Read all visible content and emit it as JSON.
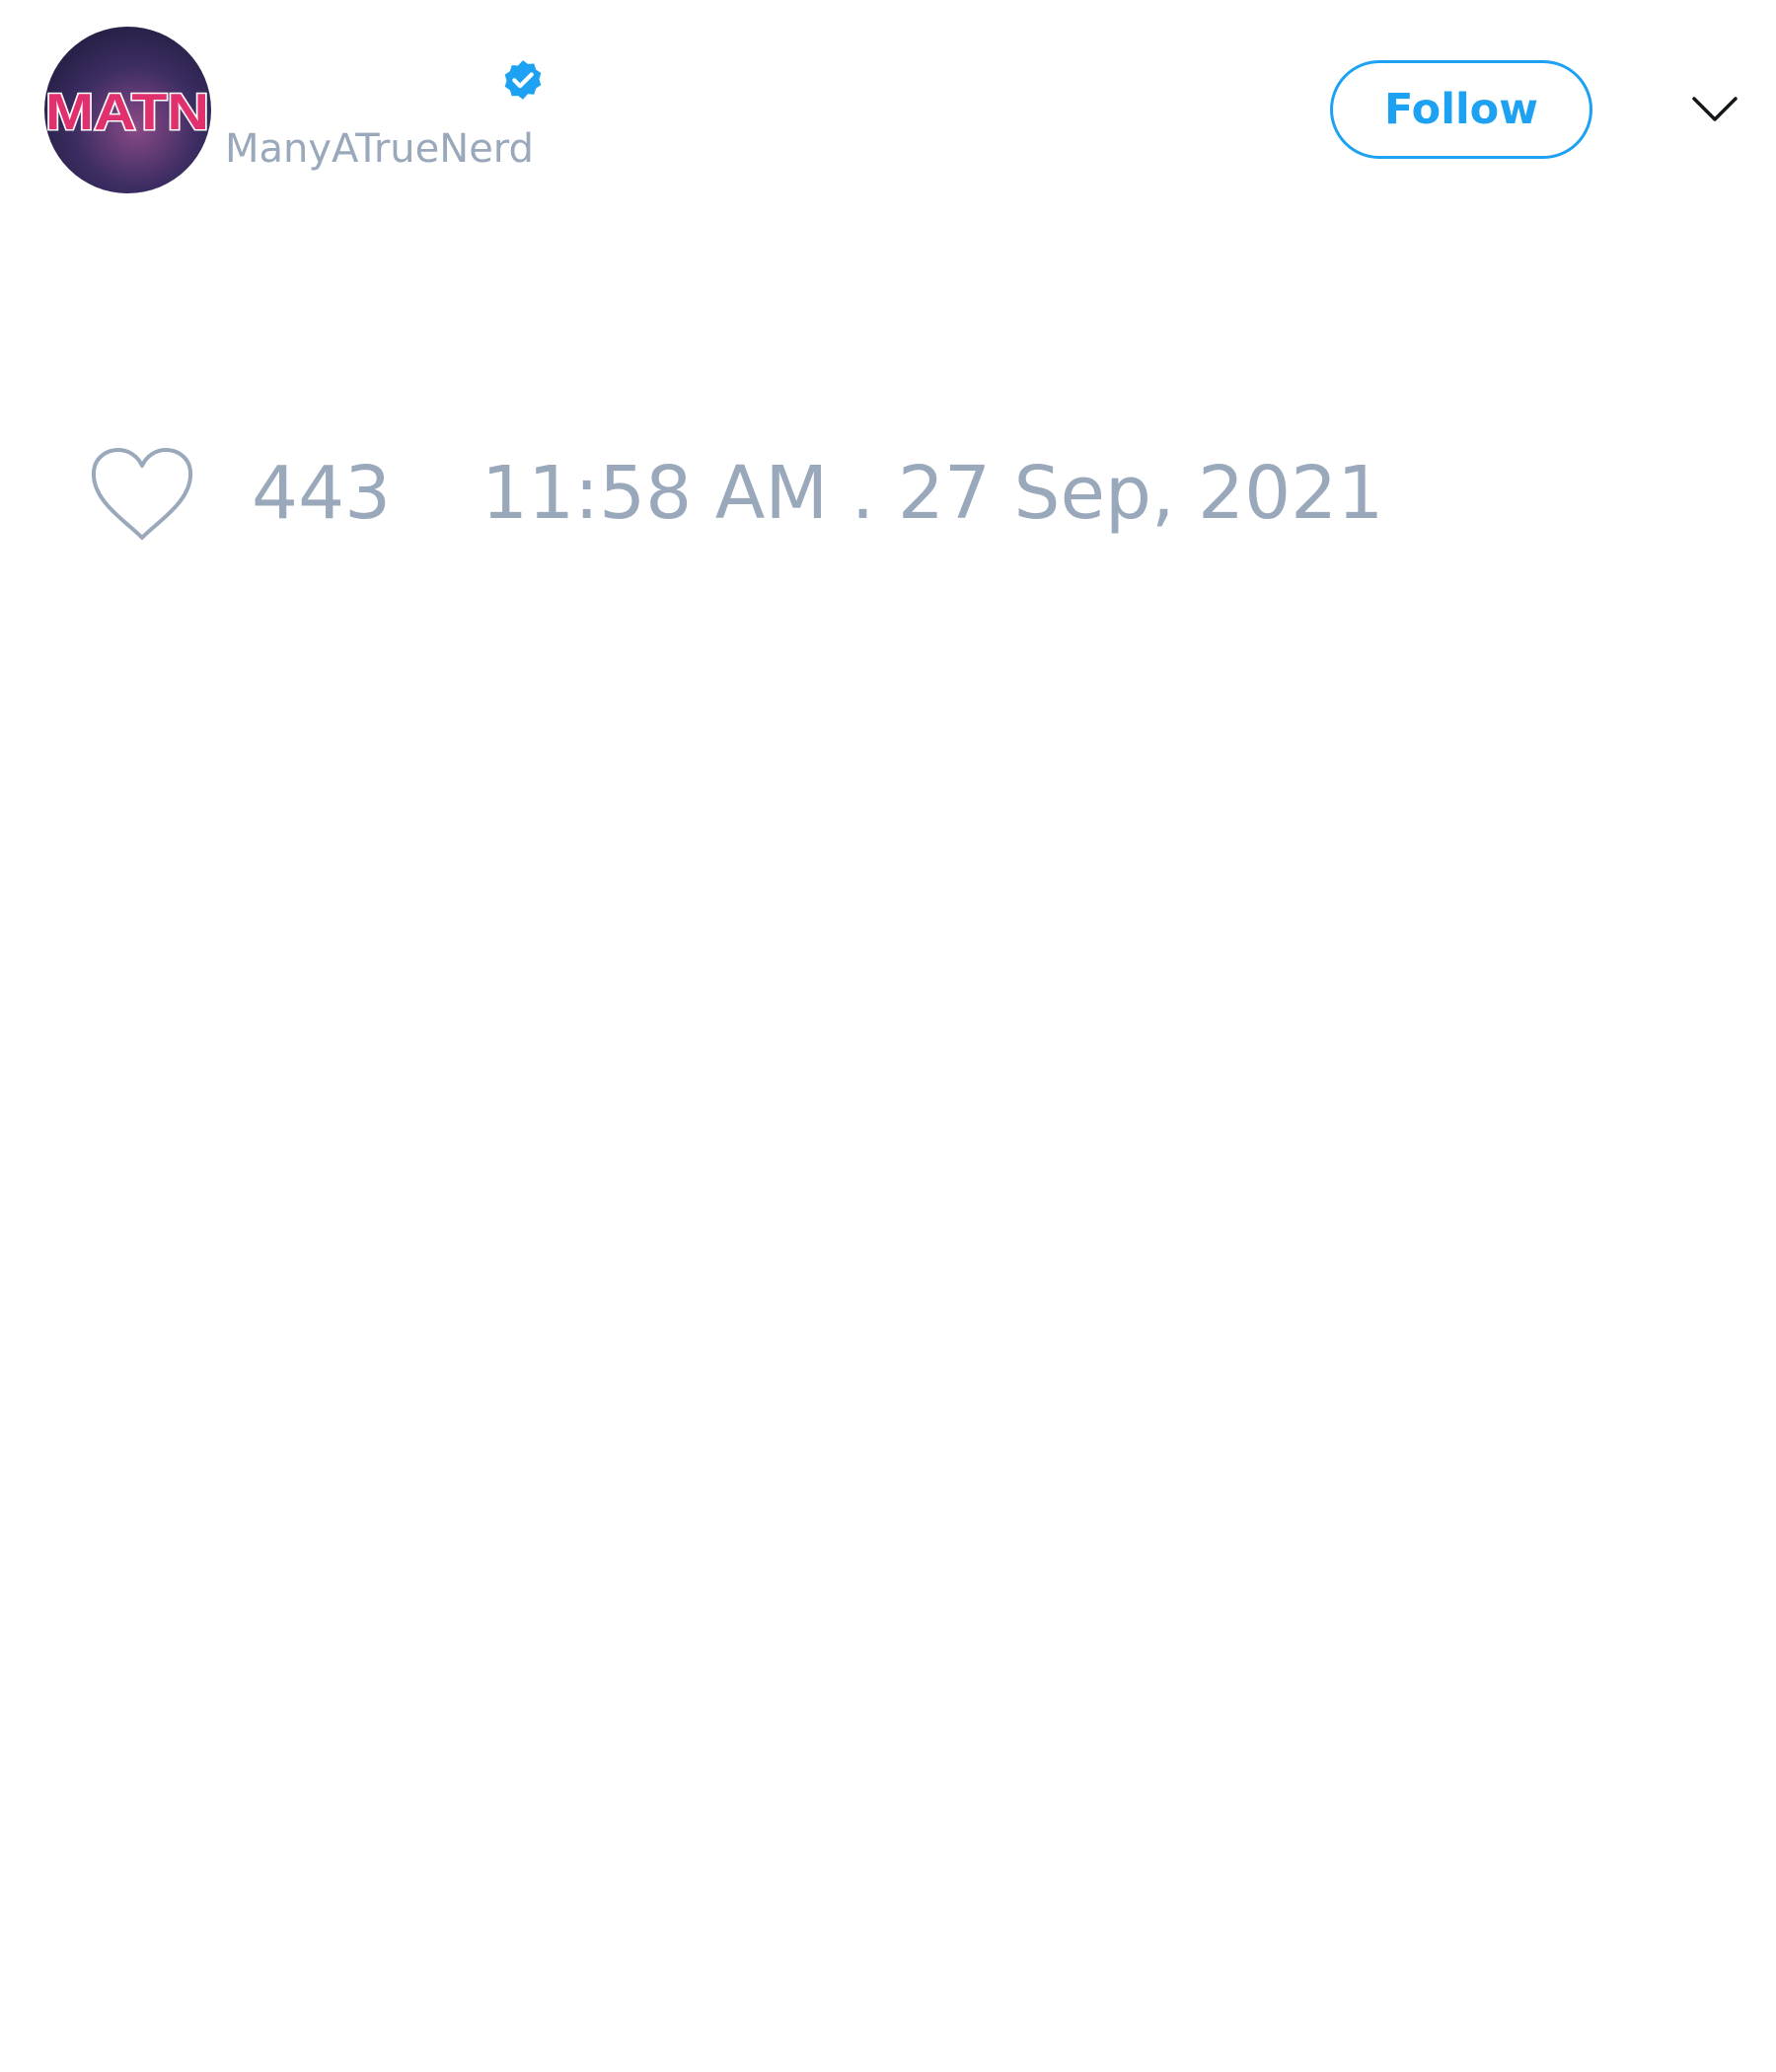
{
  "tweet": {
    "author": {
      "handle": "ManyATrueNerd",
      "avatar_text": "MATN",
      "verified": true,
      "verified_icon": "verified-badge-icon"
    },
    "follow_label": "Follow",
    "menu_icon": "chevron-down-icon",
    "like_icon": "heart-outline-icon",
    "like_count": "443",
    "timestamp": "11:58 AM . 27 Sep, 2021"
  },
  "colors": {
    "accent": "#1da1f2",
    "muted_text": "#9aa8bb",
    "avatar_text": "#e0306e",
    "background": "#ffffff"
  }
}
